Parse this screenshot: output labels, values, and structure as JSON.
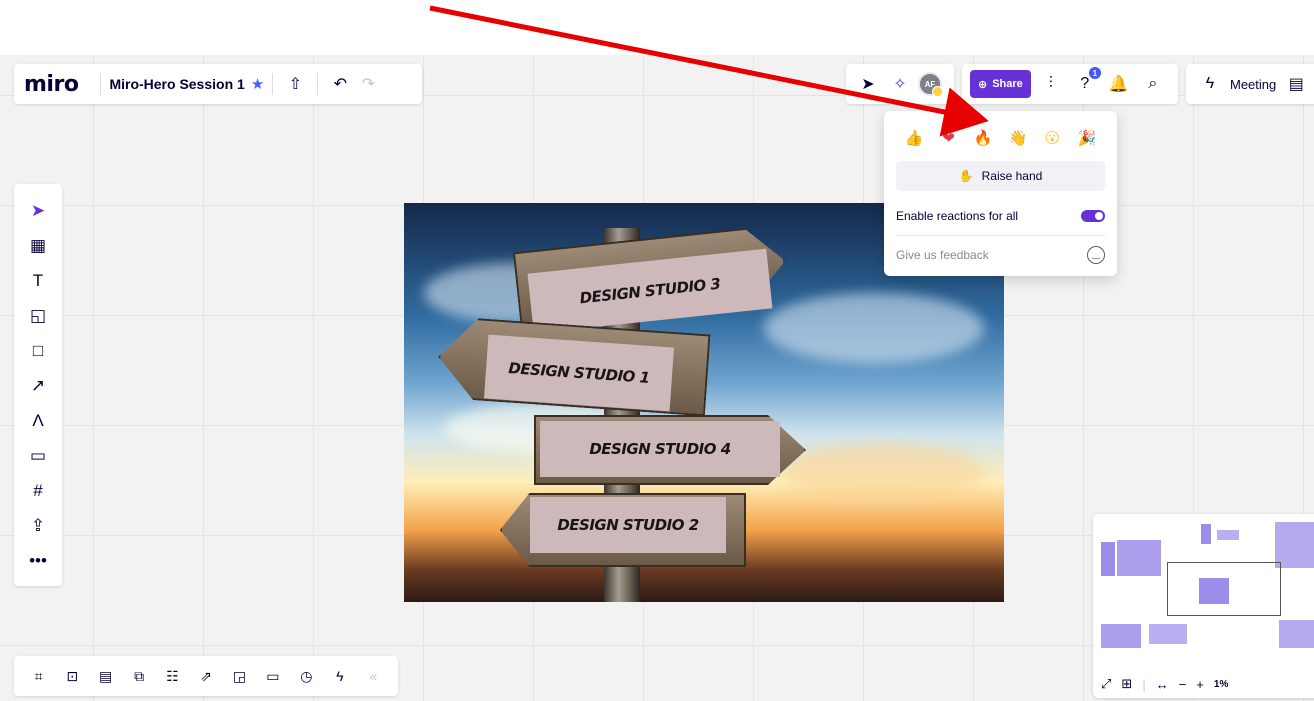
{
  "app": {
    "logo": "miro",
    "board_title": "Miro-Hero Session 1"
  },
  "header": {
    "share_label": "Share",
    "meeting_label": "Meeting",
    "avatar_initials": "AF",
    "help_badge": "1"
  },
  "reactions": {
    "emojis": [
      {
        "icon": "thumbs-up-icon",
        "glyph": "👍",
        "color": "#8b5cf6"
      },
      {
        "icon": "heart-icon",
        "glyph": "❤",
        "color": "#e5364b"
      },
      {
        "icon": "fire-icon",
        "glyph": "🔥",
        "color": "#ff8a00"
      },
      {
        "icon": "clap-icon",
        "glyph": "👋",
        "color": "#ffd43b"
      },
      {
        "icon": "surprised-icon",
        "glyph": "😮",
        "color": "#ffc83d"
      },
      {
        "icon": "party-popper-icon",
        "glyph": "🎉",
        "color": "#5ac66b"
      }
    ],
    "raise_hand_label": "Raise hand",
    "enable_reactions_label": "Enable reactions for all",
    "enable_reactions_on": true,
    "feedback_label": "Give us feedback"
  },
  "photo": {
    "signs": [
      "DESIGN STUDIO 3",
      "DESIGN STUDIO 1",
      "DESIGN STUDIO 4",
      "DESIGN STUDIO 2"
    ]
  },
  "minimap": {
    "zoom": "1%"
  },
  "colors": {
    "accent": "#6631d7",
    "annotation": "#e60000"
  }
}
